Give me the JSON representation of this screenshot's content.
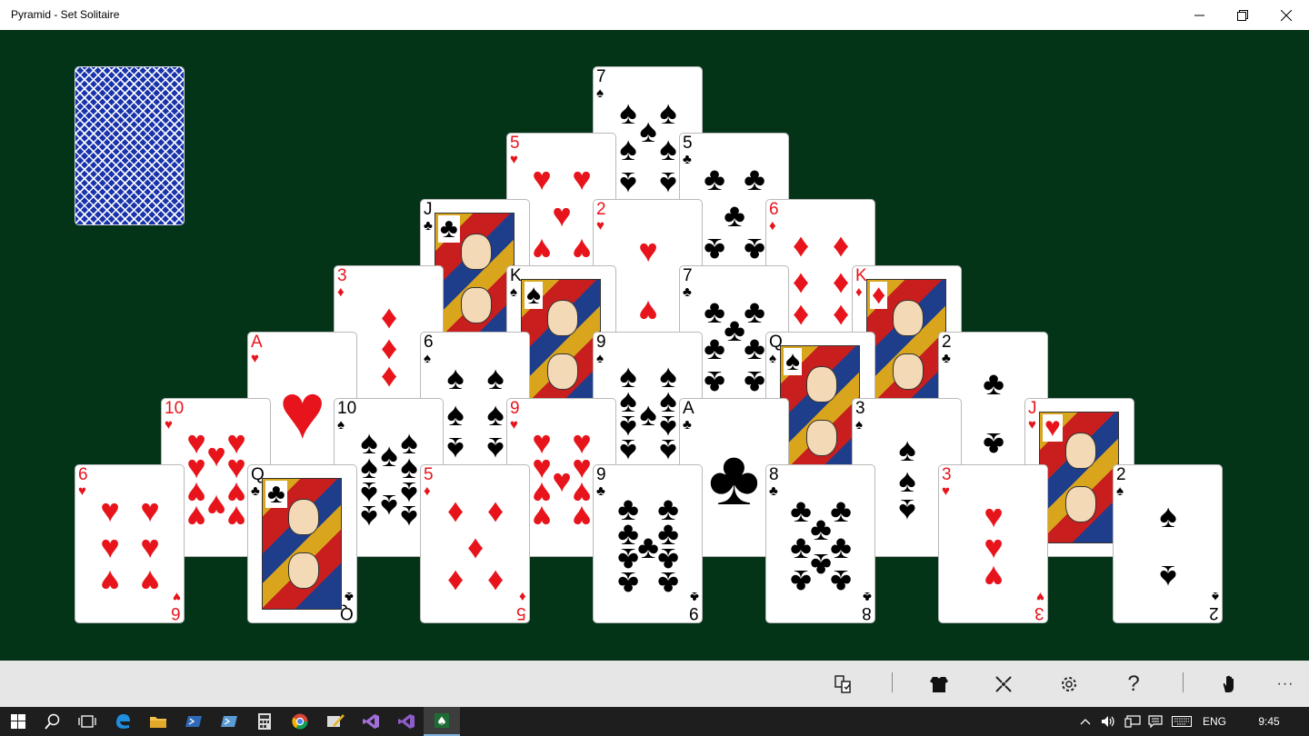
{
  "window": {
    "title": "Pyramid - Set Solitaire"
  },
  "stock": {
    "label": "stock-pile"
  },
  "pyramid": [
    {
      "rank": "7",
      "suit": "♠",
      "color": "black",
      "face": false
    },
    {
      "rank": "5",
      "suit": "♥",
      "color": "red",
      "face": false
    },
    {
      "rank": "5",
      "suit": "♣",
      "color": "black",
      "face": false
    },
    {
      "rank": "J",
      "suit": "♣",
      "color": "black",
      "face": true
    },
    {
      "rank": "2",
      "suit": "♥",
      "color": "red",
      "face": false
    },
    {
      "rank": "6",
      "suit": "♦",
      "color": "red",
      "face": false
    },
    {
      "rank": "3",
      "suit": "♦",
      "color": "red",
      "face": false
    },
    {
      "rank": "K",
      "suit": "♠",
      "color": "black",
      "face": true
    },
    {
      "rank": "7",
      "suit": "♣",
      "color": "black",
      "face": false
    },
    {
      "rank": "K",
      "suit": "♦",
      "color": "red",
      "face": true
    },
    {
      "rank": "A",
      "suit": "♥",
      "color": "red",
      "face": false
    },
    {
      "rank": "6",
      "suit": "♠",
      "color": "black",
      "face": false
    },
    {
      "rank": "9",
      "suit": "♠",
      "color": "black",
      "face": false
    },
    {
      "rank": "Q",
      "suit": "♠",
      "color": "black",
      "face": true
    },
    {
      "rank": "2",
      "suit": "♣",
      "color": "black",
      "face": false
    },
    {
      "rank": "10",
      "suit": "♥",
      "color": "red",
      "face": false
    },
    {
      "rank": "10",
      "suit": "♠",
      "color": "black",
      "face": false
    },
    {
      "rank": "9",
      "suit": "♥",
      "color": "red",
      "face": false
    },
    {
      "rank": "A",
      "suit": "♣",
      "color": "black",
      "face": false
    },
    {
      "rank": "3",
      "suit": "♠",
      "color": "black",
      "face": false
    },
    {
      "rank": "J",
      "suit": "♥",
      "color": "red",
      "face": true
    },
    {
      "rank": "6",
      "suit": "♥",
      "color": "red",
      "face": false
    },
    {
      "rank": "Q",
      "suit": "♣",
      "color": "black",
      "face": true
    },
    {
      "rank": "5",
      "suit": "♦",
      "color": "red",
      "face": false
    },
    {
      "rank": "9",
      "suit": "♣",
      "color": "black",
      "face": false
    },
    {
      "rank": "8",
      "suit": "♣",
      "color": "black",
      "face": false
    },
    {
      "rank": "3",
      "suit": "♥",
      "color": "red",
      "face": false
    },
    {
      "rank": "2",
      "suit": "♠",
      "color": "black",
      "face": false
    }
  ],
  "commandbar": {
    "items": [
      "hint-icon",
      "card-back-icon",
      "new-game-icon",
      "settings-icon",
      "help-icon",
      "hand-icon",
      "more-icon"
    ],
    "more_label": "···",
    "help_label": "?"
  },
  "taskbar": {
    "apps": [
      "start",
      "search",
      "task-view",
      "edge",
      "file-explorer",
      "powershell",
      "powershell-ise",
      "calculator",
      "chrome",
      "paint",
      "visual-studio",
      "visual-studio-2",
      "solitaire"
    ],
    "language": "ENG",
    "time": "9:45"
  },
  "colors": {
    "felt": "#033418",
    "red": "#e8141b",
    "cmdbar": "#e6e6e6",
    "taskbar": "#1e1e1e"
  }
}
